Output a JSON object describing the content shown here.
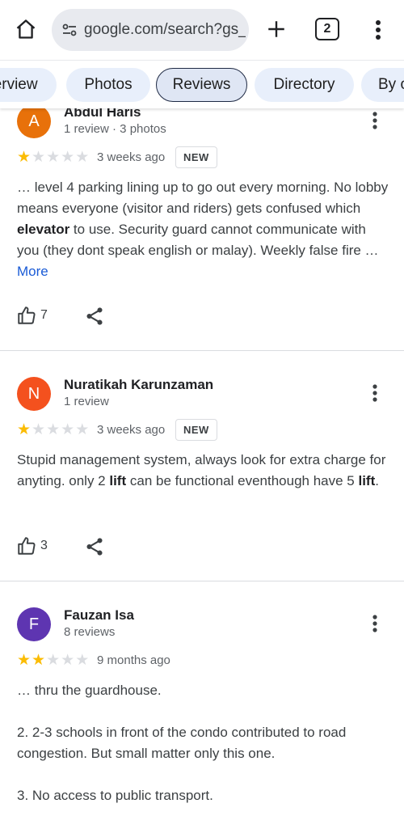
{
  "browser": {
    "url": "google.com/search?gs_",
    "tab_count": "2"
  },
  "chips": [
    {
      "label": "Overview"
    },
    {
      "label": "Photos"
    },
    {
      "label": "Reviews"
    },
    {
      "label": "Directory"
    },
    {
      "label": "By o"
    }
  ],
  "colors": {
    "avatar_orange": "#e8710a",
    "avatar_red": "#f4511e",
    "avatar_purple": "#5e35b1",
    "star_filled": "#fbbc04",
    "link_blue": "#1a5bd6"
  },
  "reviews": [
    {
      "initial": "A",
      "name": "Abdul Haris",
      "meta": "1 review · 3 photos",
      "rating": 1,
      "date": "3 weeks ago",
      "badge": "NEW",
      "text_before": "… level 4 parking lining up to go out every morning. No lobby means everyone (visitor and riders) gets confused which ",
      "text_bold": "elevator",
      "text_after": " to use. Security guard cannot communicate with you (they dont speak english or malay). Weekly false fire … ",
      "more_label": "More",
      "likes": "7"
    },
    {
      "initial": "N",
      "name": "Nuratikah Karunzaman",
      "meta": "1 review",
      "rating": 1,
      "date": "3 weeks ago",
      "badge": "NEW",
      "text_a": "Stupid management system, always look for extra charge for anyting. only 2 ",
      "text_b1": "lift",
      "text_c": " can be functional eventhough have 5 ",
      "text_b2": "lift",
      "text_d": ".",
      "likes": "3"
    },
    {
      "initial": "F",
      "name": "Fauzan Isa",
      "meta": "8 reviews",
      "rating": 2,
      "date": "9 months ago",
      "paragraphs": [
        "… thru the guardhouse.",
        "2. 2-3 schools in front of the condo contributed to road congestion. But small matter only this one.",
        "3. No access to public transport."
      ]
    }
  ]
}
